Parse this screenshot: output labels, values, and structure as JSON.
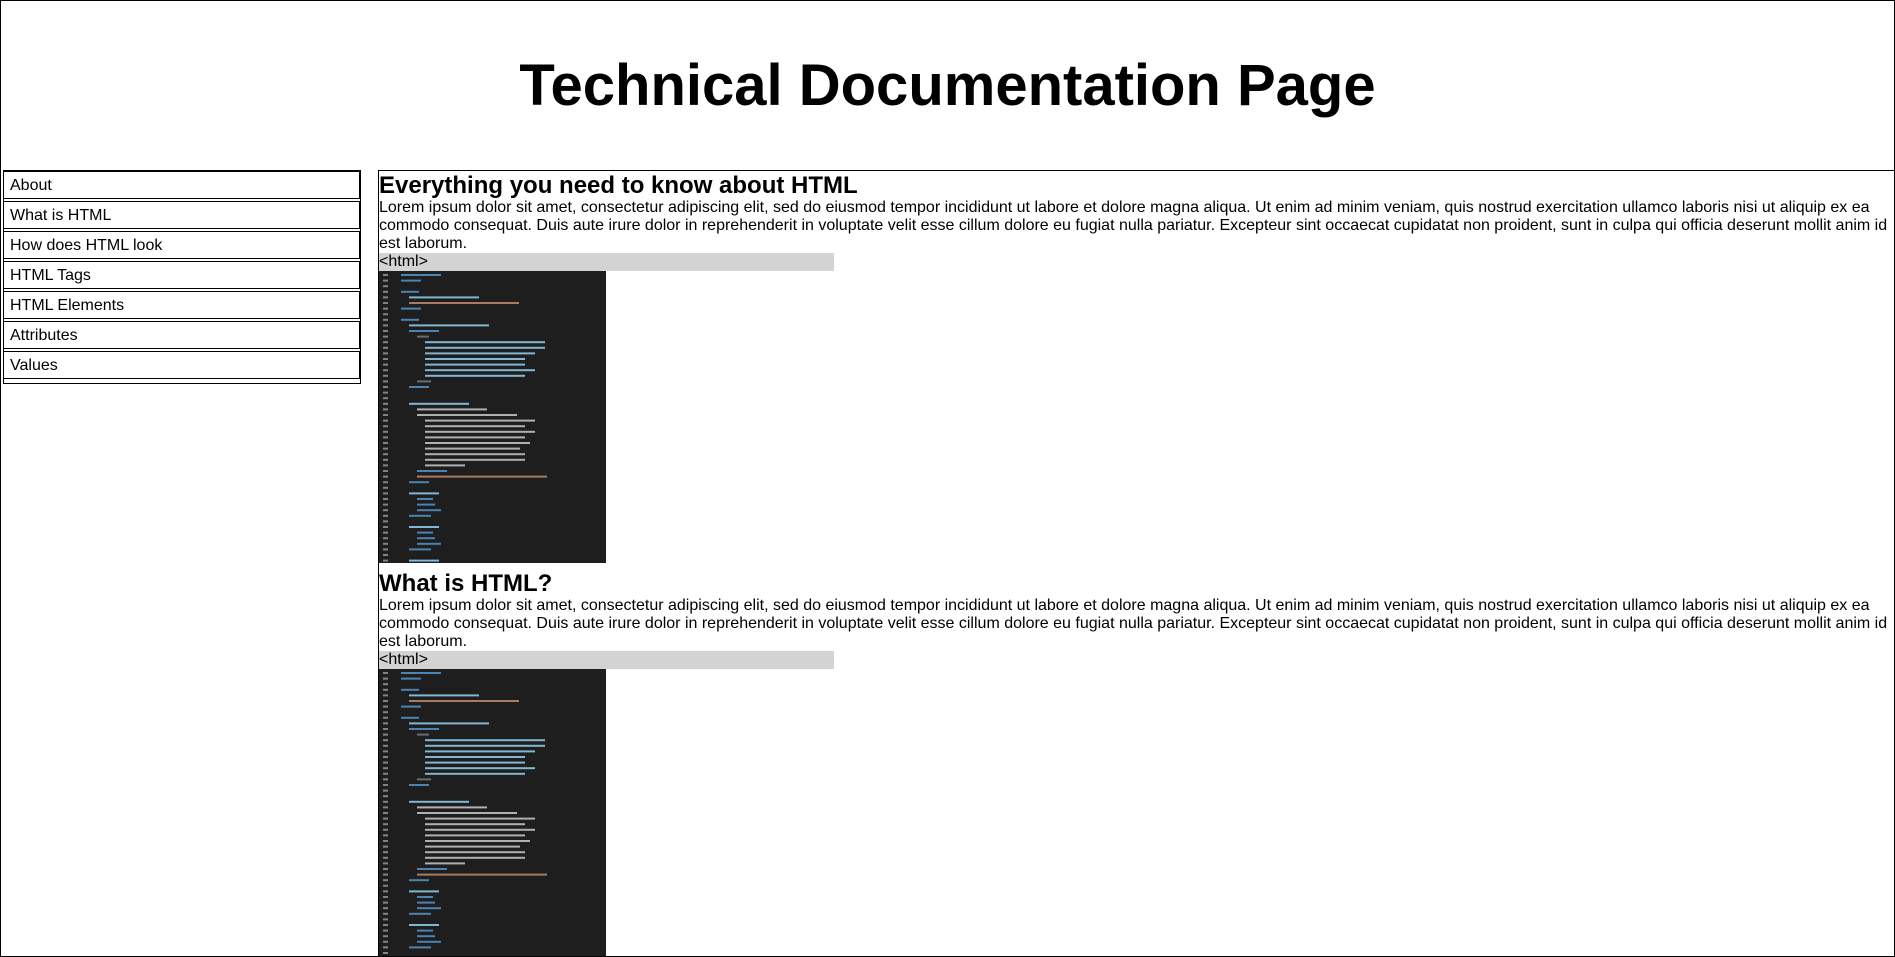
{
  "header": {
    "title": "Technical Documentation Page"
  },
  "nav": {
    "items": [
      {
        "label": "About"
      },
      {
        "label": "What is HTML"
      },
      {
        "label": "How does HTML look"
      },
      {
        "label": "HTML Tags"
      },
      {
        "label": "HTML Elements"
      },
      {
        "label": "Attributes"
      },
      {
        "label": "Values"
      }
    ]
  },
  "sections": [
    {
      "heading": "Everything you need to know about HTML",
      "body": "Lorem ipsum dolor sit amet, consectetur adipiscing elit, sed do eiusmod tempor incididunt ut labore et dolore magna aliqua. Ut enim ad minim veniam, quis nostrud exercitation ullamco laboris nisi ut aliquip ex ea commodo consequat. Duis aute irure dolor in reprehenderit in voluptate velit esse cillum dolore eu fugiat nulla pariatur. Excepteur sint occaecat cupidatat non proident, sunt in culpa qui officia deserunt mollit anim id est laborum.",
      "code": "<html>"
    },
    {
      "heading": "What is HTML?",
      "body": "Lorem ipsum dolor sit amet, consectetur adipiscing elit, sed do eiusmod tempor incididunt ut labore et dolore magna aliqua. Ut enim ad minim veniam, quis nostrud exercitation ullamco laboris nisi ut aliquip ex ea commodo consequat. Duis aute irure dolor in reprehenderit in voluptate velit esse cillum dolore eu fugiat nulla pariatur. Excepteur sint occaecat cupidatat non proident, sunt in culpa qui officia deserunt mollit anim id est laborum.",
      "code": "<html>"
    }
  ],
  "colors": {
    "code_background": "#d3d3d3",
    "editor_background": "#1e1e1e"
  }
}
